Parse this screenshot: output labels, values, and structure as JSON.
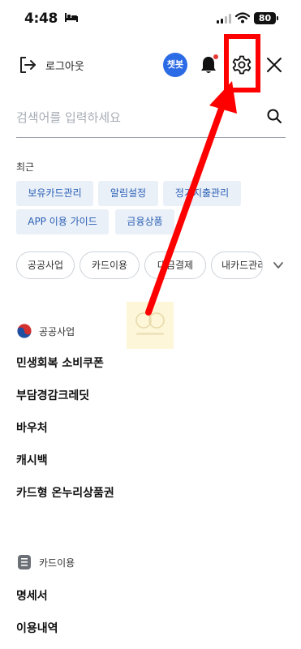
{
  "status": {
    "time": "4:48",
    "battery": "80"
  },
  "header": {
    "logout_label": "로그아웃",
    "chatbot_label": "챗봇"
  },
  "search": {
    "placeholder": "검색어를 입력하세요",
    "value": ""
  },
  "recent": {
    "title": "최근",
    "chips": [
      "보유카드관리",
      "알림설정",
      "정기지출관리",
      "APP 이용 가이드",
      "금융상품"
    ]
  },
  "categories": [
    "공공사업",
    "카드이용",
    "대금결제",
    "내카드관리"
  ],
  "sections": [
    {
      "label": "공공사업",
      "items": [
        "민생회복 소비쿠폰",
        "부담경감크레딧",
        "바우처",
        "캐시백",
        "카드형 온누리상품권"
      ]
    },
    {
      "label": "카드이용",
      "items": [
        "명세서",
        "이용내역"
      ]
    }
  ],
  "colors": {
    "chatbot_bg": "#2c6be6",
    "chip_bg": "#eaf0f8",
    "chip_text": "#2a5fb5",
    "highlight_red": "#ff0000",
    "notification_dot": "#e53935"
  }
}
